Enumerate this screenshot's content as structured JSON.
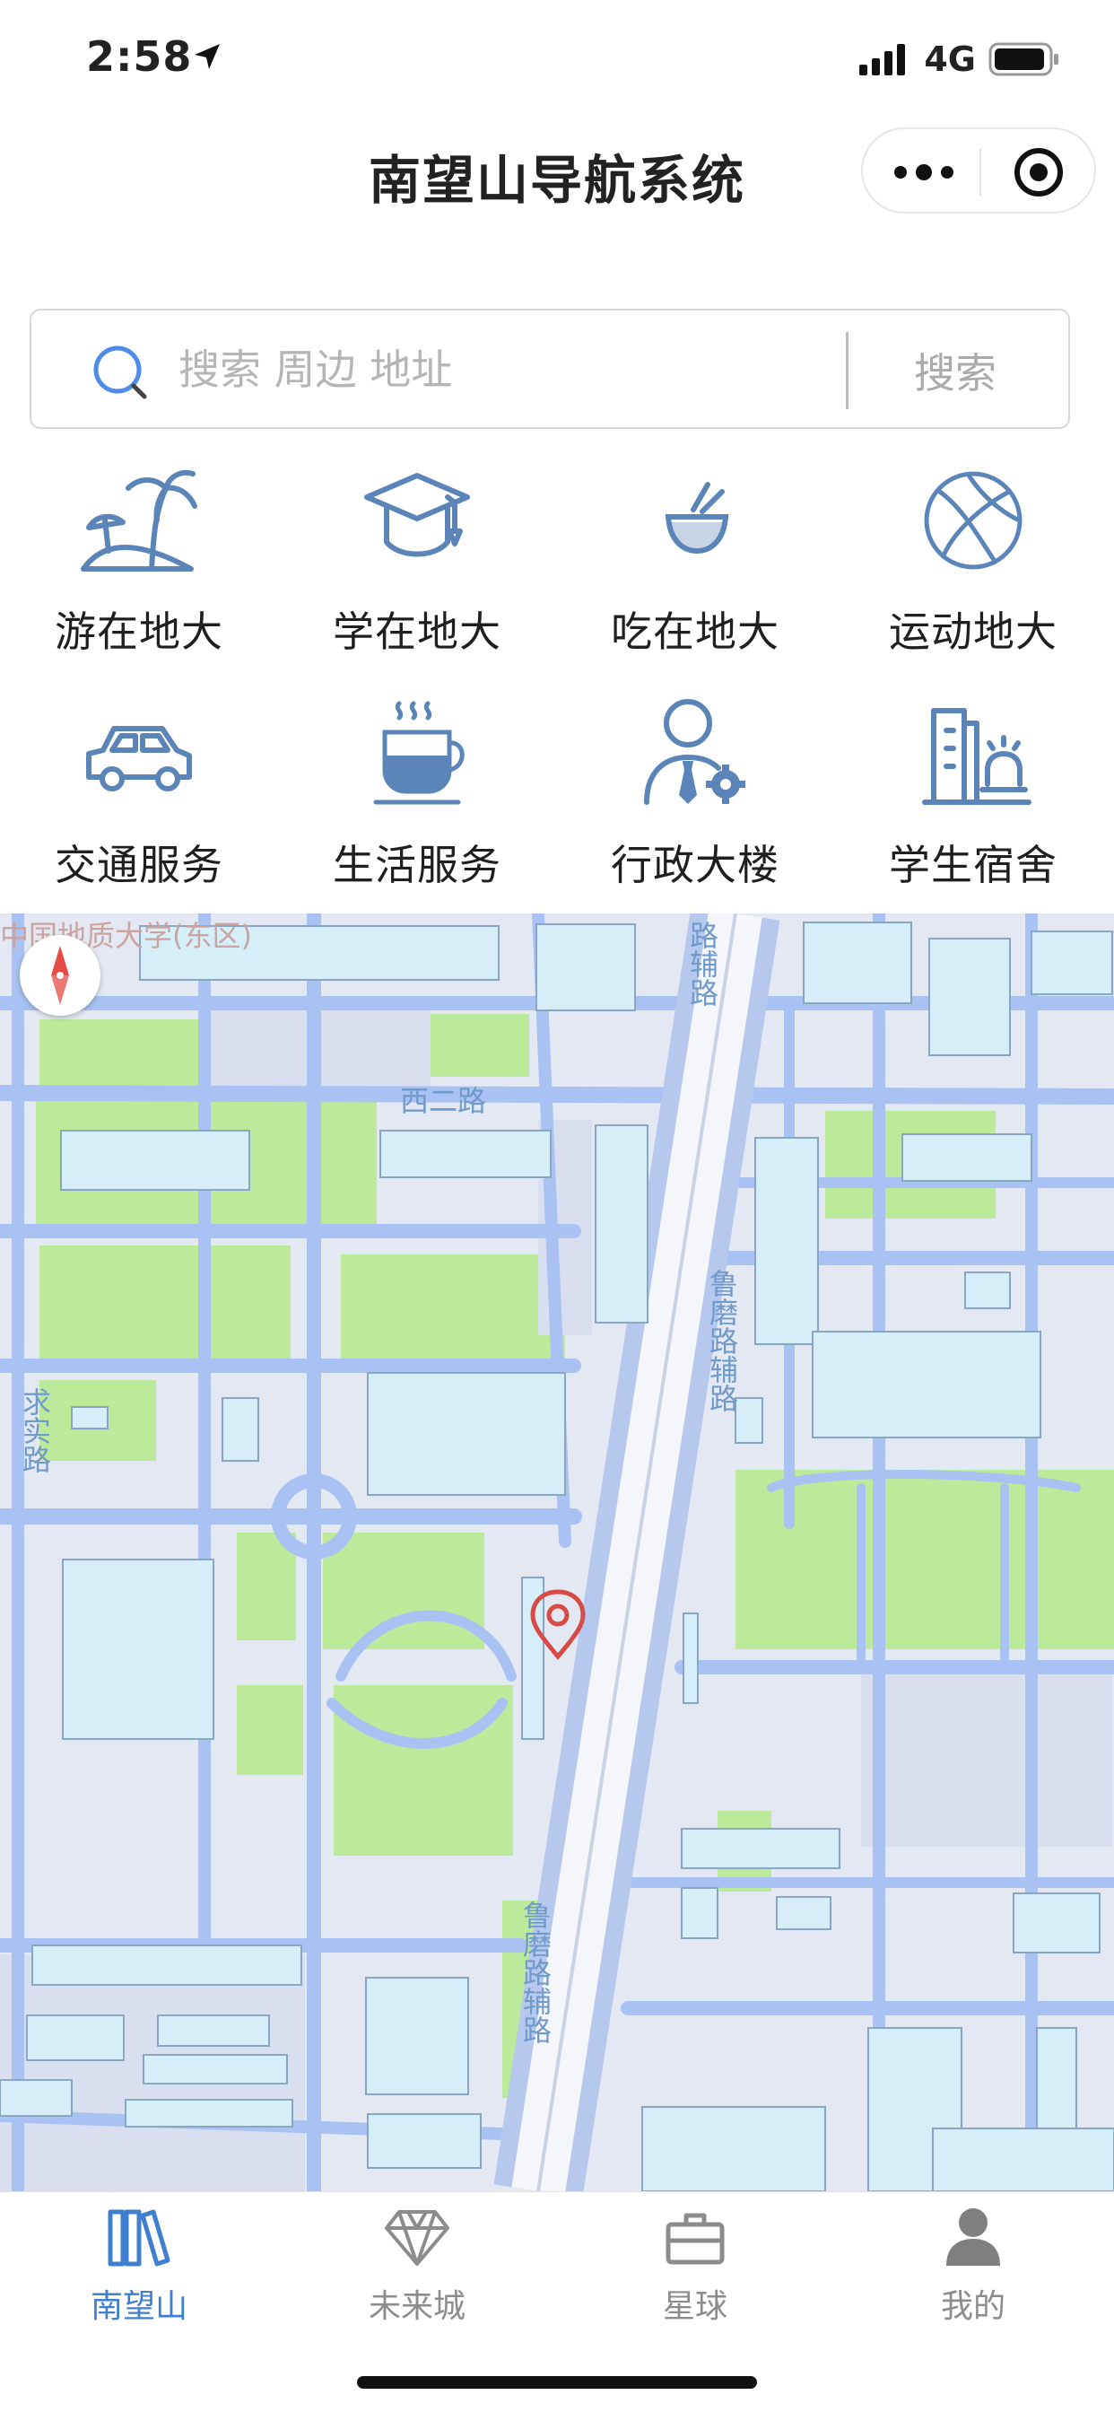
{
  "status_bar": {
    "time": "2:58",
    "network": "4G"
  },
  "header": {
    "title": "南望山导航系统"
  },
  "search": {
    "placeholder": "搜索 周边 地址",
    "value": "",
    "button_label": "搜索"
  },
  "categories": [
    {
      "label": "游在地大",
      "icon": "palm-beach-icon"
    },
    {
      "label": "学在地大",
      "icon": "graduation-cap-icon"
    },
    {
      "label": "吃在地大",
      "icon": "food-bowl-icon"
    },
    {
      "label": "运动地大",
      "icon": "basketball-icon"
    },
    {
      "label": "交通服务",
      "icon": "car-icon"
    },
    {
      "label": "生活服务",
      "icon": "coffee-cup-icon"
    },
    {
      "label": "行政大楼",
      "icon": "admin-person-icon"
    },
    {
      "label": "学生宿舍",
      "icon": "dormitory-building-icon"
    }
  ],
  "map": {
    "labels": {
      "campus": "中国地质大学(东区)",
      "west_road": "西二路",
      "lulu_side_road_top": "路辅路",
      "lulu_side_road_mid": "鲁磨路辅路",
      "qiushi_road": "求实路",
      "lulu_side_road_bottom": "鲁磨路辅路"
    },
    "colors": {
      "road": "#aac3f2",
      "green": "#bde99a",
      "building": "#d6eef7",
      "pin": "#d84a45"
    }
  },
  "tabbar": {
    "items": [
      {
        "label": "南望山",
        "icon": "books-icon",
        "active": true
      },
      {
        "label": "未来城",
        "icon": "diamond-icon",
        "active": false
      },
      {
        "label": "星球",
        "icon": "briefcase-icon",
        "active": false
      },
      {
        "label": "我的",
        "icon": "user-icon",
        "active": false
      }
    ],
    "active_color": "#3f7fcf",
    "inactive_color": "#8c8c8c"
  }
}
